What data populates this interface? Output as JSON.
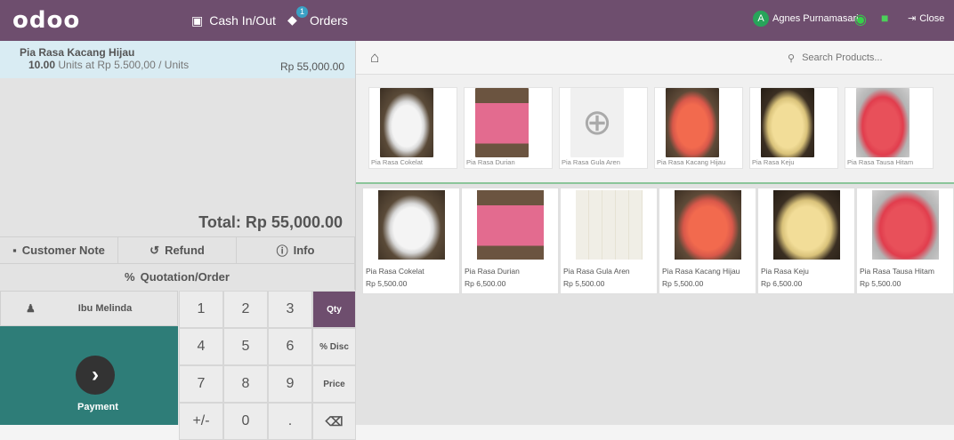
{
  "topbar": {
    "logo": "odoo",
    "cash_label": "Cash In/Out",
    "orders_label": "Orders",
    "orders_count": "1",
    "user_initial": "A",
    "user_name": "Agnes Purnamasari",
    "close_label": "Close"
  },
  "order": {
    "line_name": "Pia Rasa Kacang Hijau",
    "line_qty": "10.00",
    "line_unit_detail": "Units at Rp 5.500,00 / Units",
    "line_price": "Rp 55,000.00",
    "total": "Total: Rp 55,000.00"
  },
  "controls": {
    "customer_note": "Customer Note",
    "refund": "Refund",
    "info": "Info",
    "quotation": "Quotation/Order"
  },
  "pad": {
    "customer": "Ibu Melinda",
    "payment": "Payment",
    "keys": [
      "1",
      "2",
      "3",
      "4",
      "5",
      "6",
      "7",
      "8",
      "9",
      "+/-",
      "0",
      "."
    ],
    "modes": [
      "Qty",
      "% Disc",
      "Price"
    ],
    "backspace": "⌫"
  },
  "search": {
    "placeholder": "Search Products..."
  },
  "categories": [
    {
      "name": "Pia Rasa Cokelat"
    },
    {
      "name": "Pia Rasa Durian"
    },
    {
      "name": "Pia Rasa Gula Aren"
    },
    {
      "name": "Pia Rasa Kacang Hijau"
    },
    {
      "name": "Pia Rasa Keju"
    },
    {
      "name": "Pia Rasa Tausa Hitam"
    }
  ],
  "products": [
    {
      "name": "Pia Rasa Cokelat",
      "price": "Rp 5,500.00"
    },
    {
      "name": "Pia Rasa Durian",
      "price": "Rp 6,500.00"
    },
    {
      "name": "Pia Rasa Gula Aren",
      "price": "Rp 5,500.00"
    },
    {
      "name": "Pia Rasa Kacang Hijau",
      "price": "Rp 5,500.00"
    },
    {
      "name": "Pia Rasa Keju",
      "price": "Rp 6,500.00"
    },
    {
      "name": "Pia Rasa Tausa Hitam",
      "price": "Rp 5,500.00"
    }
  ],
  "colors": {
    "topbar": "#6e4e6e",
    "payment": "#2e7d78",
    "orderline": "#d9ecf3"
  }
}
